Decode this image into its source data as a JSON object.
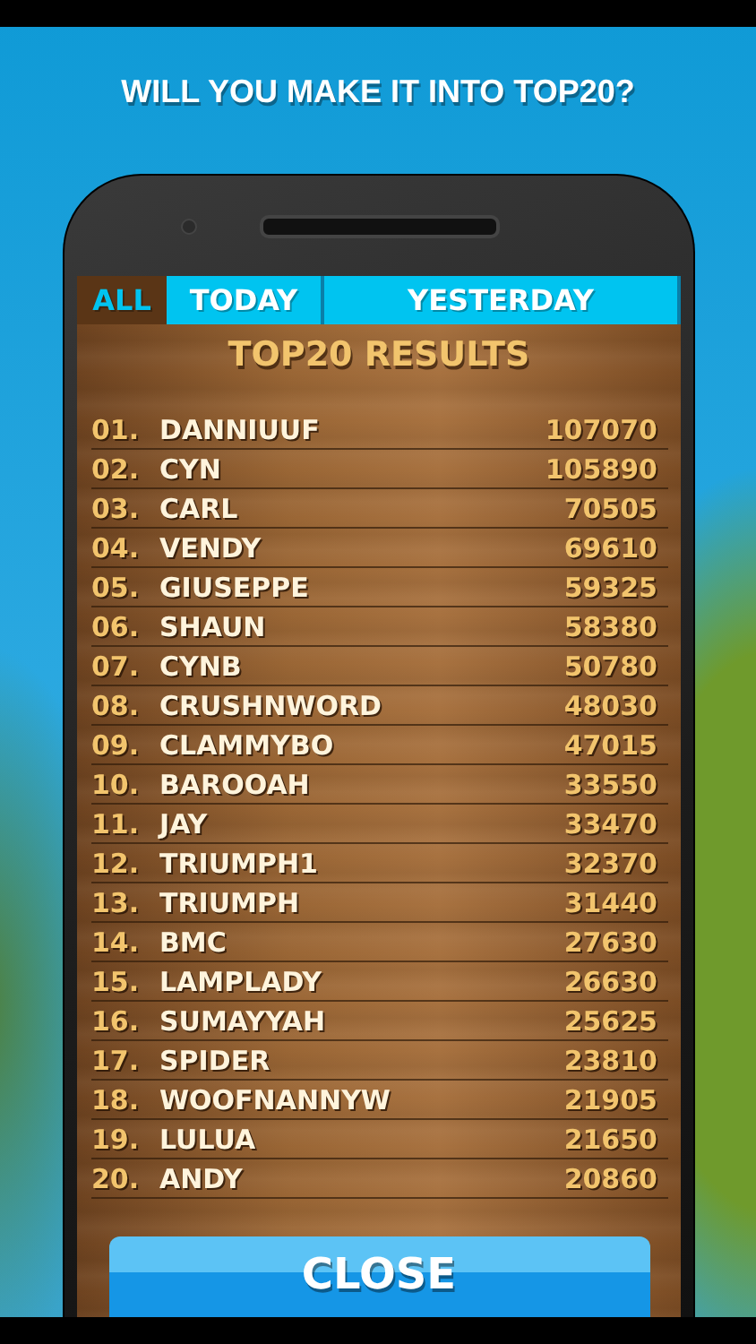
{
  "headline": "WILL YOU MAKE IT INTO TOP20?",
  "tabs": [
    {
      "label": "ALL",
      "selected": true
    },
    {
      "label": "TODAY",
      "selected": false
    },
    {
      "label": "YESTERDAY",
      "selected": false
    }
  ],
  "title": "TOP20 RESULTS",
  "rows": [
    {
      "rank": "01.",
      "name": "DANNIUUF",
      "score": "107070"
    },
    {
      "rank": "02.",
      "name": "CYN",
      "score": "105890"
    },
    {
      "rank": "03.",
      "name": "CARL",
      "score": "70505"
    },
    {
      "rank": "04.",
      "name": "VENDY",
      "score": "69610"
    },
    {
      "rank": "05.",
      "name": "GIUSEPPE",
      "score": "59325"
    },
    {
      "rank": "06.",
      "name": "SHAUN",
      "score": "58380"
    },
    {
      "rank": "07.",
      "name": "CYNB",
      "score": "50780"
    },
    {
      "rank": "08.",
      "name": "CRUSHNWORD",
      "score": "48030"
    },
    {
      "rank": "09.",
      "name": "CLAMMYBO",
      "score": "47015"
    },
    {
      "rank": "10.",
      "name": "BAROOAH",
      "score": "33550"
    },
    {
      "rank": "11.",
      "name": "JAY",
      "score": "33470"
    },
    {
      "rank": "12.",
      "name": "TRIUMPH1",
      "score": "32370"
    },
    {
      "rank": "13.",
      "name": "TRIUMPH",
      "score": "31440"
    },
    {
      "rank": "14.",
      "name": "BMC",
      "score": "27630"
    },
    {
      "rank": "15.",
      "name": "LAMPLADY",
      "score": "26630"
    },
    {
      "rank": "16.",
      "name": "SUMAYYAH",
      "score": "25625"
    },
    {
      "rank": "17.",
      "name": "SPIDER",
      "score": "23810"
    },
    {
      "rank": "18.",
      "name": "WOOFNANNYW",
      "score": "21905"
    },
    {
      "rank": "19.",
      "name": "LULUA",
      "score": "21650"
    },
    {
      "rank": "20.",
      "name": "ANDY",
      "score": "20860"
    }
  ],
  "close_button": "CLOSE"
}
